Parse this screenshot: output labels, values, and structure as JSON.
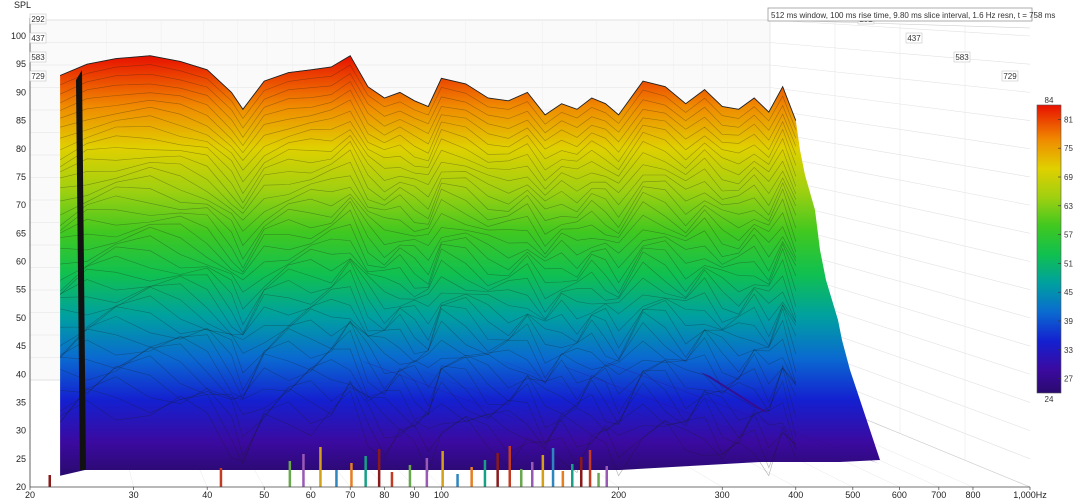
{
  "chart_data": {
    "type": "waterfall",
    "info_text": "512 ms window, 100 ms rise time, 9.80 ms slice interval, 1.6 Hz resn, t = 758 ms",
    "y_axis": {
      "label": "SPL",
      "range": [
        20,
        100
      ],
      "ticks": [
        "100",
        "95",
        "90",
        "85",
        "80",
        "75",
        "70",
        "65",
        "60",
        "55",
        "50",
        "45",
        "40",
        "35",
        "30",
        "25",
        "20"
      ]
    },
    "x_axis": {
      "scale": "log",
      "range": [
        20,
        1000
      ],
      "ticks": [
        {
          "v": 20,
          "t": "20"
        },
        {
          "v": 30,
          "t": "30"
        },
        {
          "v": 40,
          "t": "40"
        },
        {
          "v": 50,
          "t": "50"
        },
        {
          "v": 60,
          "t": "60"
        },
        {
          "v": 70,
          "t": "70"
        },
        {
          "v": 80,
          "t": "80"
        },
        {
          "v": 90,
          "t": "90"
        },
        {
          "v": 100,
          "t": "100"
        },
        {
          "v": 200,
          "t": "200"
        },
        {
          "v": 300,
          "t": "300"
        },
        {
          "v": 400,
          "t": "400"
        },
        {
          "v": 500,
          "t": "500"
        },
        {
          "v": 600,
          "t": "600"
        },
        {
          "v": 700,
          "t": "700"
        },
        {
          "v": 800,
          "t": "800"
        },
        {
          "v": 1000,
          "t": "1,000Hz"
        }
      ]
    },
    "time_ticks_ms": [
      "292",
      "437",
      "583",
      "729"
    ],
    "colorbar": {
      "min": 24,
      "max": 84,
      "ticks": [
        "84",
        "81",
        "75",
        "69",
        "63",
        "57",
        "51",
        "45",
        "39",
        "33",
        "27",
        "24"
      ]
    },
    "front_slice": {
      "freq_hz": [
        22.5,
        25,
        28,
        32,
        36,
        40,
        44,
        46,
        50,
        55,
        60,
        65,
        70,
        75,
        80,
        85,
        90,
        95,
        100,
        110,
        120,
        130,
        140,
        150,
        160,
        170,
        180,
        190,
        200,
        220,
        240,
        260,
        280,
        300,
        320,
        340,
        360,
        380,
        400
      ],
      "spl_db": [
        93,
        95,
        96,
        96.5,
        95.5,
        94,
        90,
        87,
        92,
        93.5,
        94,
        94.5,
        96.5,
        91,
        89,
        90,
        88.5,
        87.5,
        92.5,
        91.5,
        89,
        88.5,
        90,
        86,
        88,
        87,
        89,
        88,
        86,
        92,
        91,
        88,
        90.5,
        87.5,
        87,
        89,
        86.5,
        91,
        85
      ]
    },
    "decay_slices": 40,
    "bottom_spike_freqs_hz": [
      21.5,
      42,
      55,
      58,
      62,
      66,
      70,
      74,
      78,
      82,
      88,
      94,
      100,
      106,
      112,
      118,
      124,
      130,
      136,
      142,
      148,
      154,
      160,
      166,
      172,
      178,
      184,
      190
    ]
  }
}
